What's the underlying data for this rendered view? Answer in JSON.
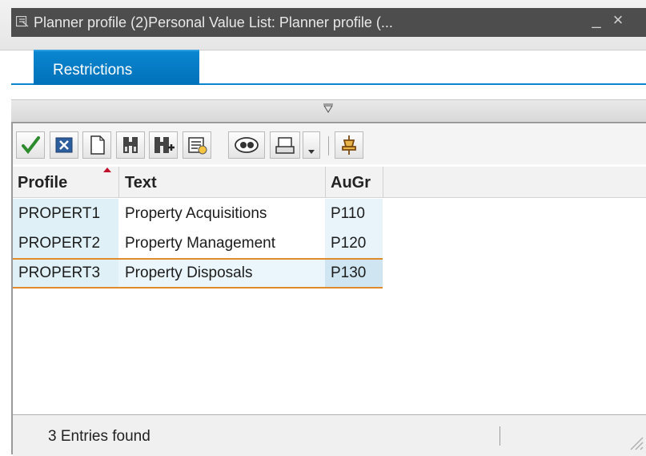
{
  "window": {
    "title": "Planner profile (2)Personal Value List: Planner profile (...",
    "minimize_label": "_",
    "close_label": "×"
  },
  "tabs": [
    {
      "label": "Restrictions",
      "active": true
    }
  ],
  "toolbar": {
    "buttons": [
      {
        "name": "continue",
        "icon": "green-check-icon"
      },
      {
        "name": "cancel",
        "icon": "cancel-x-icon"
      },
      {
        "name": "new",
        "icon": "document-icon"
      },
      {
        "name": "find",
        "icon": "binoculars-icon"
      },
      {
        "name": "find-next",
        "icon": "binoculars-plus-icon"
      },
      {
        "name": "details",
        "icon": "details-icon"
      },
      {
        "name": "view",
        "icon": "view-icon"
      },
      {
        "name": "print",
        "icon": "printer-icon"
      },
      {
        "name": "print-menu",
        "icon": "dropdown-arrow-icon"
      },
      {
        "name": "personal-list",
        "icon": "pin-icon"
      }
    ]
  },
  "table": {
    "columns": [
      "Profile",
      "Text",
      "AuGr"
    ],
    "sort_column": "Profile",
    "rows": [
      {
        "profile": "PROPERT1",
        "text": "Property Acquisitions",
        "augr": "P110"
      },
      {
        "profile": "PROPERT2",
        "text": "Property Management",
        "augr": "P120"
      },
      {
        "profile": "PROPERT3",
        "text": "Property Disposals",
        "augr": "P130",
        "selected": true
      }
    ]
  },
  "status": {
    "text": "3 Entries found"
  },
  "colors": {
    "tab_blue": "#0a86d0",
    "title_dark": "#4d4d4d",
    "selection_orange": "#e08a2a",
    "key_cell_bg": "#dff0f7",
    "check_green": "#2e8b2e",
    "sort_arrow": "#c0102a"
  }
}
